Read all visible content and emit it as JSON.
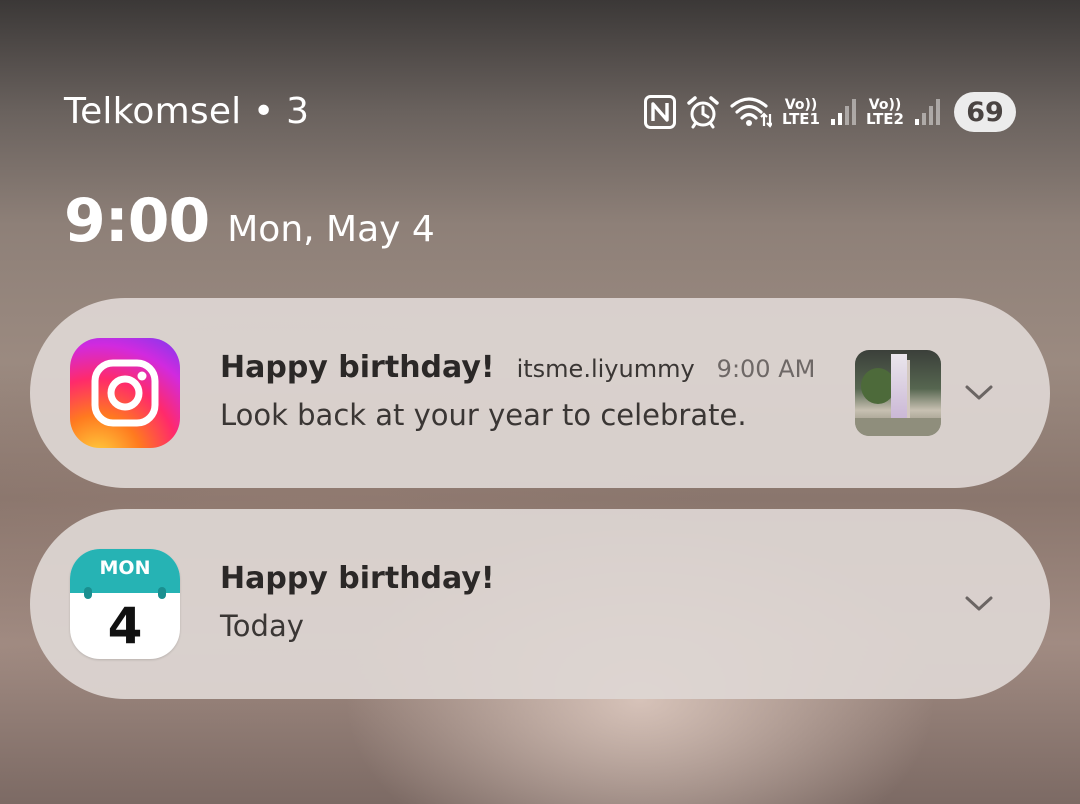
{
  "status_bar": {
    "carrier": "Telkomsel • 3",
    "icons": [
      "nfc-icon",
      "alarm-icon",
      "wifi-icon",
      "signal-sim1-icon",
      "signal-sim2-icon"
    ],
    "sim1": {
      "top": "Vo))",
      "bottom": "LTE1"
    },
    "sim2": {
      "top": "Vo))",
      "bottom": "LTE2"
    },
    "battery": "69"
  },
  "lockscreen": {
    "time": "9:00",
    "date": "Mon, May 4"
  },
  "notifications": [
    {
      "app_icon": "instagram-icon",
      "title": "Happy birthday!",
      "username": "itsme.liyummy",
      "time": "9:00 AM",
      "body": "Look back at your year to celebrate.",
      "has_thumbnail": true
    },
    {
      "app_icon": "calendar-icon",
      "calendar_month": "MON",
      "calendar_day": "4",
      "title": "Happy birthday!",
      "body": "Today"
    }
  ],
  "colors": {
    "instagram_gradient": [
      "#ffd640",
      "#ff2a6b",
      "#7a3af0"
    ],
    "calendar_accent": "#26b3b4",
    "battery_bg": "#ececec"
  }
}
